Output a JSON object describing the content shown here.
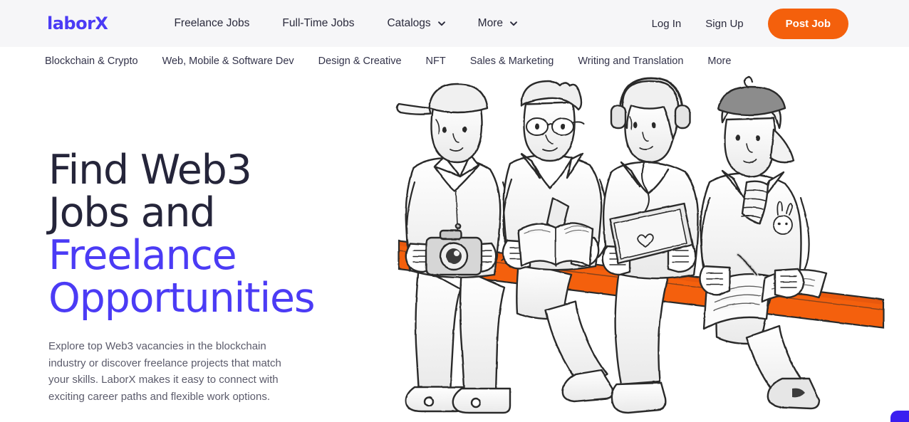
{
  "brand": {
    "logo_text": "laborX",
    "logo_color": "#4b3bf5",
    "accent_orange": "#f4600c",
    "header_bg": "#f6f6f8"
  },
  "header": {
    "nav": [
      {
        "label": "Freelance Jobs",
        "has_caret": false,
        "icon": ""
      },
      {
        "label": "Full-Time Jobs",
        "has_caret": false,
        "icon": ""
      },
      {
        "label": "Catalogs",
        "has_caret": true,
        "icon": "chevron-down-icon"
      },
      {
        "label": "More",
        "has_caret": true,
        "icon": "chevron-down-icon"
      }
    ],
    "login_label": "Log In",
    "signup_label": "Sign Up",
    "post_job_label": "Post Job"
  },
  "subnav": {
    "items": [
      {
        "label": "Blockchain & Crypto"
      },
      {
        "label": "Web, Mobile & Software Dev"
      },
      {
        "label": "Design & Creative"
      },
      {
        "label": "NFT"
      },
      {
        "label": "Sales & Marketing"
      },
      {
        "label": "Writing and Translation"
      },
      {
        "label": "More"
      }
    ]
  },
  "hero": {
    "headline_line1": "Find Web3",
    "headline_line2": "Jobs and",
    "headline_line3": "Freelance",
    "headline_line4": "Opportunities",
    "paragraph": "Explore top Web3 vacancies in the blockchain industry or discover freelance projects that match your skills. LaborX makes it easy to connect with exciting career paths and flexible work options.",
    "illustration_alt": "Four people sitting on an orange bench: a person with a cap holding a camera, a person with glasses reading a book, a person with headphones using a tablet, and a person with a beret writing in a notebook."
  },
  "widgets": {
    "chat_label": "chat-widget"
  }
}
